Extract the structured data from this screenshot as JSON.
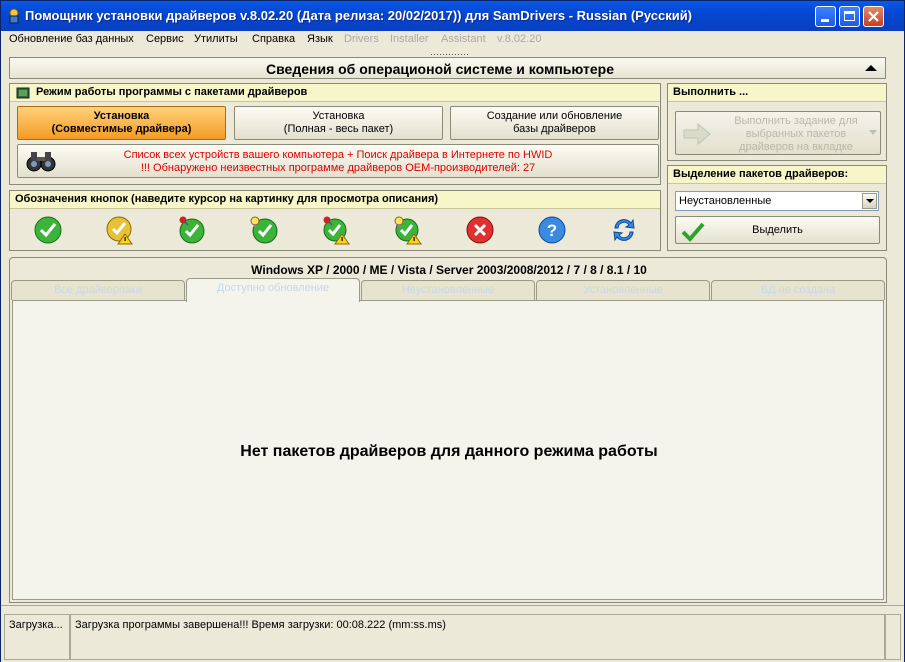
{
  "window": {
    "title": "Помощник установки драйверов v.8.02.20 (Дата релиза: 20/02/2017)) для SamDrivers - Russian (Русский)"
  },
  "menu": {
    "items": [
      "Обновление баз данных",
      "Сервис",
      "Утилиты",
      "Справка",
      "Язык"
    ],
    "disabled_items": [
      "Drivers",
      "Installer",
      "Assistant",
      "v.8.02.20"
    ]
  },
  "header": {
    "title": "Сведения об операционой системе и компьютере"
  },
  "mode_panel": {
    "title": "Режим работы программы с пакетами драйверов",
    "btn_install_compat": [
      "Установка",
      "(Совместимые драйвера)"
    ],
    "btn_install_full": [
      "Установка",
      "(Полная - весь пакет)"
    ],
    "btn_create_db": [
      "Создание или обновление",
      "базы драйверов"
    ],
    "devices_line1": "Список всех устройств вашего компьютера + Поиск драйвера в Интернете по HWID",
    "devices_line2": "!!! Обнаружено неизвестных программе драйверов OEM-производителей: 27"
  },
  "legend_panel": {
    "title": "Обозначения кнопок (наведите курсор на картинку для просмотра описания)",
    "icons": [
      "check-ok-icon",
      "check-warning-icon",
      "check-pin-icon",
      "check-bulb-icon",
      "check-pin-warning-icon",
      "check-bulb-warning-icon",
      "error-x-icon",
      "help-icon",
      "refresh-icon"
    ]
  },
  "execute_panel": {
    "title": "Выполнить ...",
    "button": [
      "Выполнить задание для",
      "выбранных пакетов",
      "драйверов на вкладке"
    ]
  },
  "select_panel": {
    "title": "Выделение пакетов драйверов:",
    "dropdown_value": "Неустановленные",
    "select_button": "Выделить"
  },
  "tabs": {
    "os_label": "Windows XP / 2000 / ME / Vista / Server 2003/2008/2012 / 7 / 8 / 8.1 / 10",
    "items": [
      "Все драйверпаки",
      "Доступно обновление",
      "Неустановленные",
      "Установленные",
      "БД не создана"
    ],
    "selected": 1,
    "empty_message": "Нет пакетов драйверов для данного режима работы"
  },
  "status": {
    "left": "Загрузка...",
    "main": "Загрузка программы завершена!!! Время загрузки: 00:08.222 (mm:ss.ms)"
  },
  "colors": {
    "accent_orange": "#f49b25",
    "title_blue": "#0447d2",
    "warning_red": "#e00000",
    "panel_title_bg": "#f7f6c8"
  }
}
